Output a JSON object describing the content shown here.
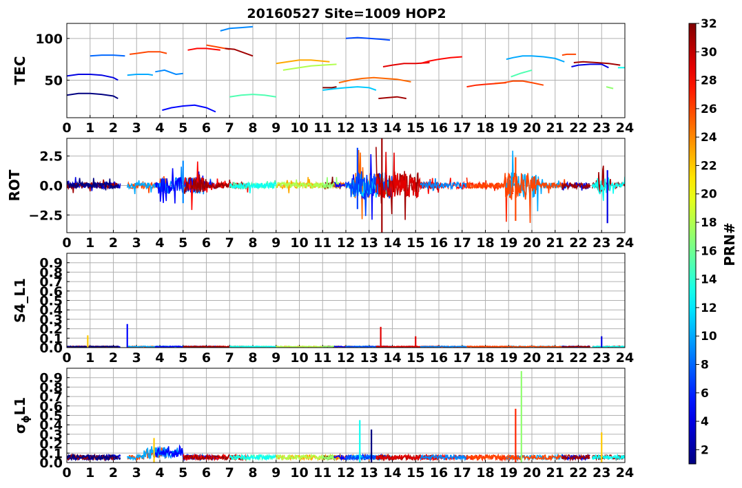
{
  "chart_data": {
    "title": "20160527 Site=1009 HOP2",
    "xlim": [
      0,
      24
    ],
    "x_ticks": [
      "0",
      "1",
      "2",
      "3",
      "4",
      "5",
      "6",
      "7",
      "8",
      "9",
      "10",
      "11",
      "12",
      "13",
      "14",
      "15",
      "16",
      "17",
      "18",
      "19",
      "20",
      "21",
      "22",
      "23",
      "24"
    ],
    "grid": true,
    "panels": [
      {
        "type": "line",
        "ylabel": "TEC",
        "ylim": [
          5,
          118
        ],
        "y_ticks": [
          {
            "v": 50,
            "label": "50"
          },
          {
            "v": 100,
            "label": "100"
          }
        ],
        "series": [
          {
            "prn": 1,
            "x": [
              0.0,
              0.5,
              1.0,
              1.5,
              2.0,
              2.2
            ],
            "y": [
              32,
              34,
              34,
              33,
              31,
              28
            ]
          },
          {
            "prn": 4,
            "x": [
              0.0,
              0.5,
              1.0,
              1.5,
              2.0,
              2.2
            ],
            "y": [
              55,
              57,
              57,
              56,
              53,
              50
            ]
          },
          {
            "prn": 8,
            "x": [
              1.0,
              1.5,
              2.0,
              2.5
            ],
            "y": [
              79,
              80,
              80,
              79
            ]
          },
          {
            "prn": 26,
            "x": [
              2.7,
              3.0,
              3.5,
              4.0,
              4.3
            ],
            "y": [
              81,
              82,
              84,
              84,
              82
            ]
          },
          {
            "prn": 10,
            "x": [
              2.6,
              3.0,
              3.5,
              3.7
            ],
            "y": [
              56,
              57,
              57,
              56
            ]
          },
          {
            "prn": 5,
            "x": [
              4.1,
              4.5,
              5.0,
              5.5,
              6.0,
              6.4
            ],
            "y": [
              14,
              17,
              19,
              20,
              17,
              12
            ]
          },
          {
            "prn": 9,
            "x": [
              3.8,
              4.2,
              4.7,
              5.0
            ],
            "y": [
              60,
              62,
              57,
              58
            ]
          },
          {
            "prn": 28,
            "x": [
              5.2,
              5.6,
              6.0,
              6.6
            ],
            "y": [
              86,
              88,
              88,
              86
            ]
          },
          {
            "prn": 26,
            "x": [
              6.0,
              6.4,
              7.0
            ],
            "y": [
              92,
              90,
              87
            ]
          },
          {
            "prn": 31,
            "x": [
              6.8,
              7.2,
              7.6,
              8.0
            ],
            "y": [
              88,
              87,
              83,
              79
            ]
          },
          {
            "prn": 9,
            "x": [
              6.6,
              7.0,
              7.5,
              8.0
            ],
            "y": [
              109,
              112,
              113,
              114
            ]
          },
          {
            "prn": 15,
            "x": [
              7.0,
              7.5,
              8.0,
              8.5,
              9.0
            ],
            "y": [
              30,
              32,
              33,
              32,
              30
            ]
          },
          {
            "prn": 23,
            "x": [
              9.0,
              9.5,
              10.0,
              10.5,
              11.3
            ],
            "y": [
              70,
              72,
              74,
              74,
              72
            ]
          },
          {
            "prn": 18,
            "x": [
              9.3,
              10.0,
              10.5,
              11.0,
              11.6
            ],
            "y": [
              62,
              65,
              67,
              68,
              69
            ]
          },
          {
            "prn": 11,
            "x": [
              11.0,
              11.6,
              12.0,
              12.5,
              13.0,
              13.3
            ],
            "y": [
              38,
              40,
              41,
              42,
              41,
              38
            ]
          },
          {
            "prn": 32,
            "x": [
              11.0,
              11.4,
              11.6
            ],
            "y": [
              41,
              41,
              42
            ]
          },
          {
            "prn": 25,
            "x": [
              11.7,
              12.2,
              12.7,
              13.2,
              13.7,
              14.2,
              14.8
            ],
            "y": [
              47,
              50,
              52,
              53,
              52,
              51,
              48
            ]
          },
          {
            "prn": 7,
            "x": [
              12.0,
              12.5,
              13.0,
              13.5,
              13.9
            ],
            "y": [
              100,
              101,
              100,
              99,
              98
            ]
          },
          {
            "prn": 31,
            "x": [
              13.4,
              13.8,
              14.2,
              14.6
            ],
            "y": [
              28,
              29,
              30,
              28
            ]
          },
          {
            "prn": 29,
            "x": [
              13.6,
              14.0,
              14.5,
              15.0,
              15.6
            ],
            "y": [
              66,
              68,
              70,
              70,
              71
            ]
          },
          {
            "prn": 28,
            "x": [
              15.2,
              15.6,
              16.0,
              16.5,
              17.0
            ],
            "y": [
              70,
              73,
              75,
              77,
              78
            ]
          },
          {
            "prn": 27,
            "x": [
              17.2,
              17.6,
              18.0,
              18.5,
              18.9
            ],
            "y": [
              42,
              44,
              45,
              46,
              47
            ]
          },
          {
            "prn": 26,
            "x": [
              18.4,
              18.8,
              19.2,
              19.6,
              20.0,
              20.5
            ],
            "y": [
              46,
              47,
              49,
              49,
              47,
              44
            ]
          },
          {
            "prn": 10,
            "x": [
              18.9,
              19.2,
              19.6,
              20.0,
              20.5,
              21.0,
              21.4
            ],
            "y": [
              75,
              77,
              79,
              79,
              78,
              76,
              72
            ]
          },
          {
            "prn": 15,
            "x": [
              19.1,
              19.5,
              20.0
            ],
            "y": [
              54,
              58,
              62
            ]
          },
          {
            "prn": 26,
            "x": [
              21.3,
              21.5,
              21.9
            ],
            "y": [
              80,
              81,
              81
            ]
          },
          {
            "prn": 4,
            "x": [
              21.7,
              22.0,
              22.5,
              23.0,
              23.3
            ],
            "y": [
              66,
              68,
              69,
              69,
              65
            ]
          },
          {
            "prn": 31,
            "x": [
              21.8,
              22.2,
              22.8,
              23.3,
              23.8
            ],
            "y": [
              71,
              72,
              71,
              70,
              68
            ]
          },
          {
            "prn": 17,
            "x": [
              23.2,
              23.5
            ],
            "y": [
              42,
              40
            ]
          },
          {
            "prn": 13,
            "x": [
              23.7,
              24.0
            ],
            "y": [
              65,
              65
            ]
          }
        ]
      },
      {
        "type": "line",
        "ylabel": "ROT",
        "ylim": [
          -4,
          4
        ],
        "y_ticks": [
          {
            "v": 2.5,
            "label": "2.5"
          },
          {
            "v": 0,
            "label": "0.0"
          },
          {
            "v": -2.5,
            "label": "−2.5"
          }
        ]
      },
      {
        "type": "line",
        "ylabel": "S4_L1",
        "ylim": [
          0,
          1
        ],
        "y_ticks": [
          {
            "v": 0,
            "label": "0.0"
          },
          {
            "v": 0.1,
            "label": "0.1"
          },
          {
            "v": 0.2,
            "label": "0.2"
          },
          {
            "v": 0.3,
            "label": "0.3"
          },
          {
            "v": 0.4,
            "label": "0.4"
          },
          {
            "v": 0.5,
            "label": "0.5"
          },
          {
            "v": 0.6,
            "label": "0.6"
          },
          {
            "v": 0.7,
            "label": "0.7"
          },
          {
            "v": 0.8,
            "label": "0.8"
          },
          {
            "v": 0.9,
            "label": "0.9"
          }
        ]
      },
      {
        "type": "line",
        "ylabel": "σφL1",
        "ylabel_main": "σ",
        "ylabel_sub": "ϕ",
        "ylabel_tail": "L1",
        "ylim": [
          0,
          1
        ],
        "y_ticks": [
          {
            "v": 0,
            "label": "0.0"
          },
          {
            "v": 0.1,
            "label": "0.1"
          },
          {
            "v": 0.2,
            "label": "0.2"
          },
          {
            "v": 0.3,
            "label": "0.3"
          },
          {
            "v": 0.4,
            "label": "0.4"
          },
          {
            "v": 0.5,
            "label": "0.5"
          },
          {
            "v": 0.6,
            "label": "0.6"
          },
          {
            "v": 0.7,
            "label": "0.7"
          },
          {
            "v": 0.8,
            "label": "0.8"
          },
          {
            "v": 0.9,
            "label": "0.9"
          }
        ]
      }
    ],
    "colorbar": {
      "label": "PRN#",
      "range": [
        1,
        32
      ],
      "ticks": [
        "2",
        "4",
        "6",
        "8",
        "10",
        "12",
        "14",
        "16",
        "18",
        "20",
        "22",
        "24",
        "26",
        "28",
        "30",
        "32"
      ],
      "colormap": "jet"
    }
  }
}
